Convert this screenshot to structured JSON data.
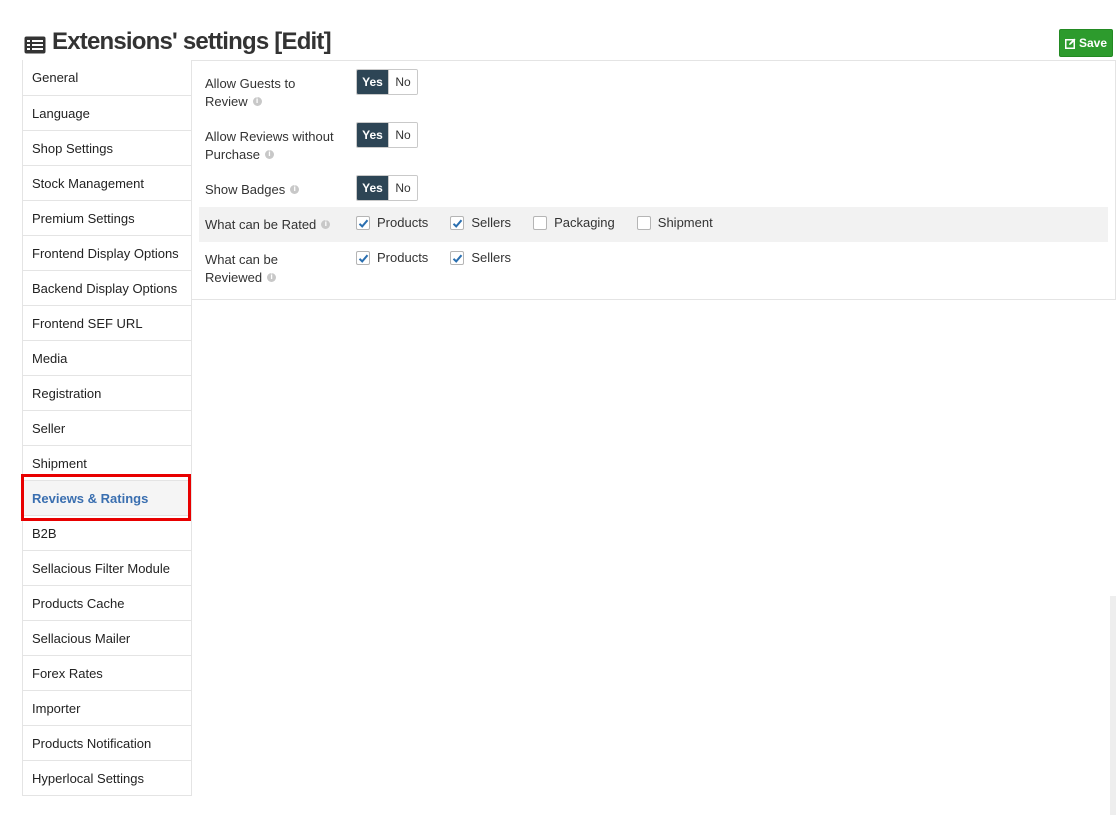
{
  "header": {
    "title": "Extensions' settings [Edit]",
    "save_label": "Save"
  },
  "sidebar": {
    "items": [
      {
        "label": "General"
      },
      {
        "label": "Language"
      },
      {
        "label": "Shop Settings"
      },
      {
        "label": "Stock Management"
      },
      {
        "label": "Premium Settings"
      },
      {
        "label": "Frontend Display Options"
      },
      {
        "label": "Backend Display Options"
      },
      {
        "label": "Frontend SEF URL"
      },
      {
        "label": "Media"
      },
      {
        "label": "Registration"
      },
      {
        "label": "Seller"
      },
      {
        "label": "Shipment"
      },
      {
        "label": "Reviews & Ratings",
        "active": true
      },
      {
        "label": "B2B"
      },
      {
        "label": "Sellacious Filter Module"
      },
      {
        "label": "Products Cache"
      },
      {
        "label": "Sellacious Mailer"
      },
      {
        "label": "Forex Rates"
      },
      {
        "label": "Importer"
      },
      {
        "label": "Products Notification"
      },
      {
        "label": "Hyperlocal Settings"
      }
    ]
  },
  "settings": {
    "allow_guests": {
      "label_line1": "Allow Guests to",
      "label_line2": "Review",
      "yes": "Yes",
      "no": "No",
      "value": "Yes"
    },
    "allow_without_purchase": {
      "label_line1": "Allow Reviews without",
      "label_line2": "Purchase",
      "yes": "Yes",
      "no": "No",
      "value": "Yes"
    },
    "show_badges": {
      "label": "Show Badges",
      "yes": "Yes",
      "no": "No",
      "value": "Yes"
    },
    "what_rated": {
      "label": "What can be Rated",
      "options": [
        {
          "label": "Products",
          "checked": true
        },
        {
          "label": "Sellers",
          "checked": true
        },
        {
          "label": "Packaging",
          "checked": false
        },
        {
          "label": "Shipment",
          "checked": false
        }
      ]
    },
    "what_reviewed": {
      "label_line1": "What can be",
      "label_line2": "Reviewed",
      "options": [
        {
          "label": "Products",
          "checked": true
        },
        {
          "label": "Sellers",
          "checked": true
        }
      ]
    }
  },
  "colors": {
    "toggle_selected": "#2d4555",
    "save_button": "#2d9b2d",
    "active_link": "#3a6fb0",
    "highlight_box": "#e80000",
    "checkmark": "#2a6fb0"
  }
}
